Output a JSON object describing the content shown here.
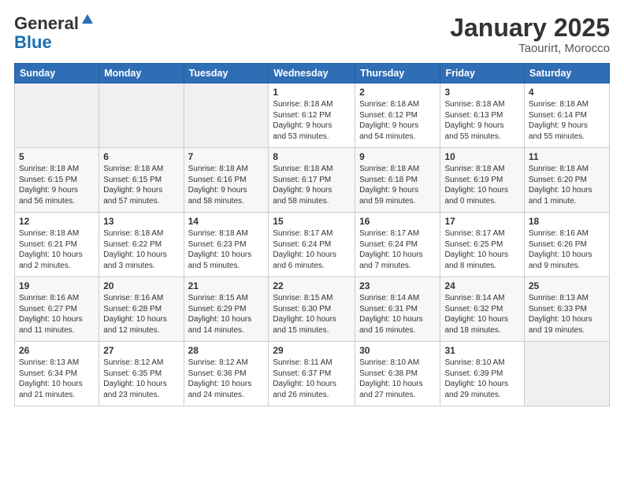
{
  "header": {
    "logo_general": "General",
    "logo_blue": "Blue",
    "month_title": "January 2025",
    "location": "Taourirt, Morocco"
  },
  "days_of_week": [
    "Sunday",
    "Monday",
    "Tuesday",
    "Wednesday",
    "Thursday",
    "Friday",
    "Saturday"
  ],
  "weeks": [
    [
      {
        "num": "",
        "info": ""
      },
      {
        "num": "",
        "info": ""
      },
      {
        "num": "",
        "info": ""
      },
      {
        "num": "1",
        "info": "Sunrise: 8:18 AM\nSunset: 6:12 PM\nDaylight: 9 hours\nand 53 minutes."
      },
      {
        "num": "2",
        "info": "Sunrise: 8:18 AM\nSunset: 6:12 PM\nDaylight: 9 hours\nand 54 minutes."
      },
      {
        "num": "3",
        "info": "Sunrise: 8:18 AM\nSunset: 6:13 PM\nDaylight: 9 hours\nand 55 minutes."
      },
      {
        "num": "4",
        "info": "Sunrise: 8:18 AM\nSunset: 6:14 PM\nDaylight: 9 hours\nand 55 minutes."
      }
    ],
    [
      {
        "num": "5",
        "info": "Sunrise: 8:18 AM\nSunset: 6:15 PM\nDaylight: 9 hours\nand 56 minutes."
      },
      {
        "num": "6",
        "info": "Sunrise: 8:18 AM\nSunset: 6:15 PM\nDaylight: 9 hours\nand 57 minutes."
      },
      {
        "num": "7",
        "info": "Sunrise: 8:18 AM\nSunset: 6:16 PM\nDaylight: 9 hours\nand 58 minutes."
      },
      {
        "num": "8",
        "info": "Sunrise: 8:18 AM\nSunset: 6:17 PM\nDaylight: 9 hours\nand 58 minutes."
      },
      {
        "num": "9",
        "info": "Sunrise: 8:18 AM\nSunset: 6:18 PM\nDaylight: 9 hours\nand 59 minutes."
      },
      {
        "num": "10",
        "info": "Sunrise: 8:18 AM\nSunset: 6:19 PM\nDaylight: 10 hours\nand 0 minutes."
      },
      {
        "num": "11",
        "info": "Sunrise: 8:18 AM\nSunset: 6:20 PM\nDaylight: 10 hours\nand 1 minute."
      }
    ],
    [
      {
        "num": "12",
        "info": "Sunrise: 8:18 AM\nSunset: 6:21 PM\nDaylight: 10 hours\nand 2 minutes."
      },
      {
        "num": "13",
        "info": "Sunrise: 8:18 AM\nSunset: 6:22 PM\nDaylight: 10 hours\nand 3 minutes."
      },
      {
        "num": "14",
        "info": "Sunrise: 8:18 AM\nSunset: 6:23 PM\nDaylight: 10 hours\nand 5 minutes."
      },
      {
        "num": "15",
        "info": "Sunrise: 8:17 AM\nSunset: 6:24 PM\nDaylight: 10 hours\nand 6 minutes."
      },
      {
        "num": "16",
        "info": "Sunrise: 8:17 AM\nSunset: 6:24 PM\nDaylight: 10 hours\nand 7 minutes."
      },
      {
        "num": "17",
        "info": "Sunrise: 8:17 AM\nSunset: 6:25 PM\nDaylight: 10 hours\nand 8 minutes."
      },
      {
        "num": "18",
        "info": "Sunrise: 8:16 AM\nSunset: 6:26 PM\nDaylight: 10 hours\nand 9 minutes."
      }
    ],
    [
      {
        "num": "19",
        "info": "Sunrise: 8:16 AM\nSunset: 6:27 PM\nDaylight: 10 hours\nand 11 minutes."
      },
      {
        "num": "20",
        "info": "Sunrise: 8:16 AM\nSunset: 6:28 PM\nDaylight: 10 hours\nand 12 minutes."
      },
      {
        "num": "21",
        "info": "Sunrise: 8:15 AM\nSunset: 6:29 PM\nDaylight: 10 hours\nand 14 minutes."
      },
      {
        "num": "22",
        "info": "Sunrise: 8:15 AM\nSunset: 6:30 PM\nDaylight: 10 hours\nand 15 minutes."
      },
      {
        "num": "23",
        "info": "Sunrise: 8:14 AM\nSunset: 6:31 PM\nDaylight: 10 hours\nand 16 minutes."
      },
      {
        "num": "24",
        "info": "Sunrise: 8:14 AM\nSunset: 6:32 PM\nDaylight: 10 hours\nand 18 minutes."
      },
      {
        "num": "25",
        "info": "Sunrise: 8:13 AM\nSunset: 6:33 PM\nDaylight: 10 hours\nand 19 minutes."
      }
    ],
    [
      {
        "num": "26",
        "info": "Sunrise: 8:13 AM\nSunset: 6:34 PM\nDaylight: 10 hours\nand 21 minutes."
      },
      {
        "num": "27",
        "info": "Sunrise: 8:12 AM\nSunset: 6:35 PM\nDaylight: 10 hours\nand 23 minutes."
      },
      {
        "num": "28",
        "info": "Sunrise: 8:12 AM\nSunset: 6:36 PM\nDaylight: 10 hours\nand 24 minutes."
      },
      {
        "num": "29",
        "info": "Sunrise: 8:11 AM\nSunset: 6:37 PM\nDaylight: 10 hours\nand 26 minutes."
      },
      {
        "num": "30",
        "info": "Sunrise: 8:10 AM\nSunset: 6:38 PM\nDaylight: 10 hours\nand 27 minutes."
      },
      {
        "num": "31",
        "info": "Sunrise: 8:10 AM\nSunset: 6:39 PM\nDaylight: 10 hours\nand 29 minutes."
      },
      {
        "num": "",
        "info": ""
      }
    ]
  ]
}
